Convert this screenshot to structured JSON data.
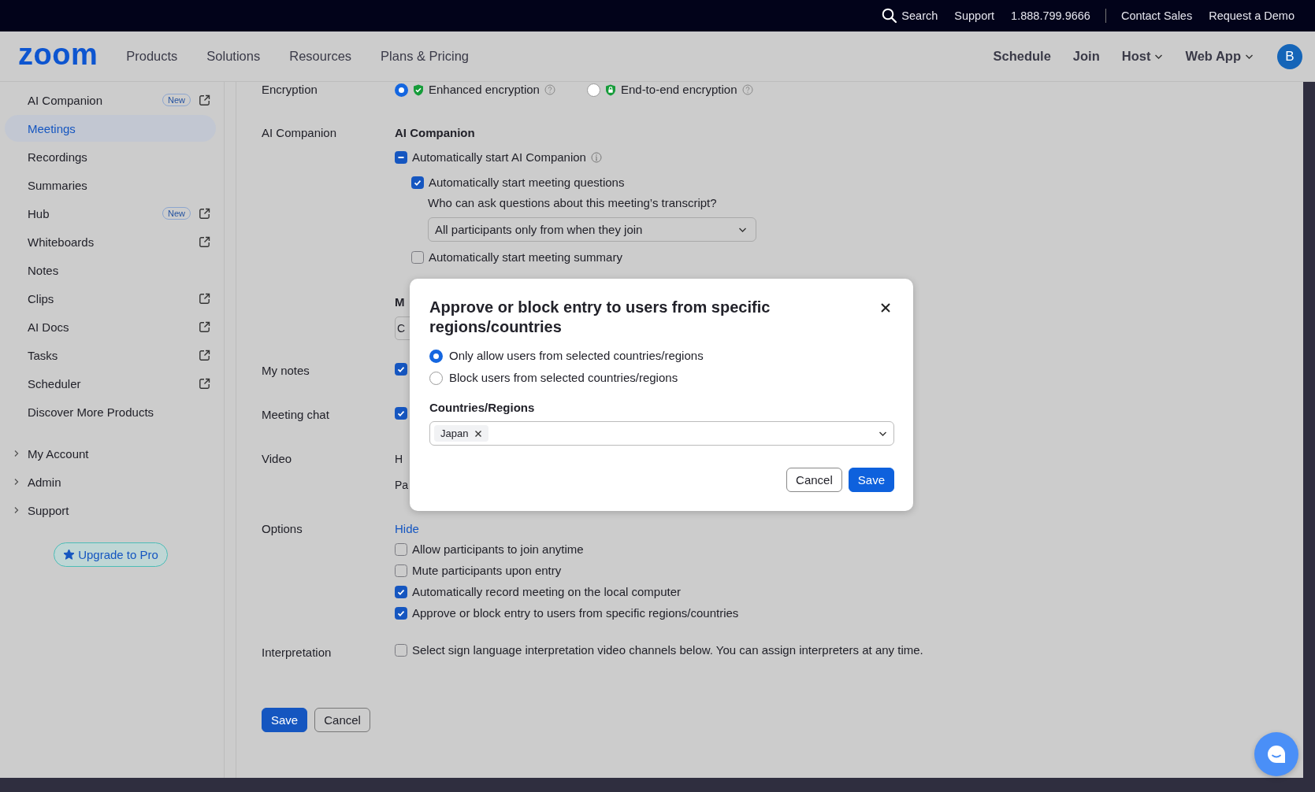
{
  "top_bar": {
    "left_links": [
      {
        "label": "Search",
        "kind": "search"
      },
      {
        "label": "Support",
        "kind": "link"
      },
      {
        "label": "1.888.799.9666",
        "kind": "link"
      }
    ],
    "right_links": [
      {
        "label": "Contact Sales",
        "kind": "link"
      },
      {
        "label": "Request a Demo",
        "kind": "link"
      }
    ]
  },
  "nav": {
    "logo": "zoom",
    "menu": [
      "Products",
      "Solutions",
      "Resources",
      "Plans & Pricing"
    ],
    "actions": [
      {
        "label": "Schedule",
        "dropdown": false
      },
      {
        "label": "Join",
        "dropdown": false
      },
      {
        "label": "Host",
        "dropdown": true
      },
      {
        "label": "Web App",
        "dropdown": true
      }
    ],
    "avatar": "B"
  },
  "sidebar": {
    "items": [
      {
        "label": "AI Companion",
        "selected": false,
        "badge": "New",
        "external": true
      },
      {
        "label": "Meetings",
        "selected": true,
        "external": false
      },
      {
        "label": "Recordings",
        "selected": false,
        "external": false
      },
      {
        "label": "Summaries",
        "selected": false,
        "external": false
      },
      {
        "label": "Hub",
        "selected": false,
        "badge": "New",
        "external": true
      },
      {
        "label": "Whiteboards",
        "selected": false,
        "external": true
      },
      {
        "label": "Notes",
        "selected": false,
        "external": false
      },
      {
        "label": "Clips",
        "selected": false,
        "external": true
      },
      {
        "label": "AI Docs",
        "selected": false,
        "external": true
      },
      {
        "label": "Tasks",
        "selected": false,
        "external": true
      },
      {
        "label": "Scheduler",
        "selected": false,
        "external": true
      },
      {
        "label": "Discover More Products",
        "selected": false,
        "external": false
      }
    ],
    "sections": [
      {
        "label": "My Account",
        "expanded": false
      },
      {
        "label": "Admin",
        "expanded": false
      },
      {
        "label": "Support",
        "expanded": false
      }
    ],
    "upgrade_button": "Upgrade to Pro"
  },
  "settings": {
    "encryption": {
      "label": "Encryption",
      "options": [
        {
          "label": "Enhanced encryption",
          "selected": true
        },
        {
          "label": "End-to-end encryption",
          "selected": false
        }
      ]
    },
    "ai_companion": {
      "label": "AI Companion",
      "heading": "AI Companion",
      "main": {
        "label": "Automatically start AI Companion",
        "checked": false,
        "indeterminate": true
      },
      "sub": [
        {
          "label": "Automatically start meeting questions",
          "checked": true,
          "question": "Who can ask questions about this meeting’s transcript?",
          "select": "All participants only from when they join"
        },
        {
          "label": "Automatically start meeting summary",
          "checked": false
        }
      ]
    },
    "covered_section": {
      "heading": "M",
      "field_value": "C"
    },
    "my_notes": {
      "label": "My notes",
      "checked": true
    },
    "meeting_chat": {
      "label": "Meeting chat",
      "checked": true
    },
    "video": {
      "label": "Video",
      "lines": [
        "H",
        "Pa"
      ]
    },
    "options": {
      "label": "Options",
      "link": "Hide",
      "items": [
        {
          "label": "Allow participants to join anytime",
          "checked": false
        },
        {
          "label": "Mute participants upon entry",
          "checked": false
        },
        {
          "label": "Automatically record meeting on the local computer",
          "checked": true
        },
        {
          "label": "Approve or block entry to users from specific regions/countries",
          "checked": true
        }
      ]
    },
    "interpretation": {
      "label": "Interpretation",
      "checked": false,
      "text": "Select sign language interpretation video channels below. You can assign interpreters at any time."
    },
    "buttons": [
      {
        "label": "Save",
        "kind": "primary"
      },
      {
        "label": "Cancel",
        "kind": "secondary"
      }
    ]
  },
  "dialog": {
    "title": "Approve or block entry to users from specific regions/countries",
    "options": [
      {
        "label": "Only allow users from selected countries/regions",
        "selected": true
      },
      {
        "label": "Block users from selected countries/regions",
        "selected": false
      }
    ],
    "field_label": "Countries/Regions",
    "tags": [
      "Japan"
    ],
    "buttons": [
      {
        "label": "Cancel",
        "kind": "secondary"
      },
      {
        "label": "Save",
        "kind": "primary"
      }
    ]
  }
}
